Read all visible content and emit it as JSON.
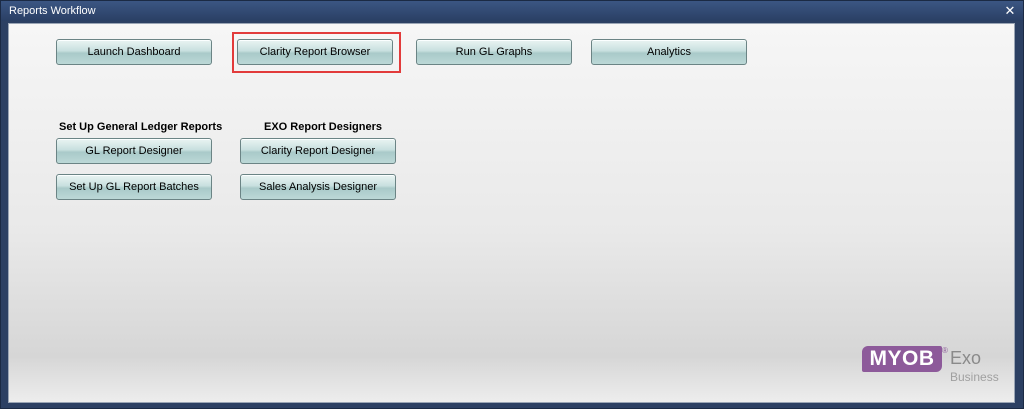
{
  "window": {
    "title": "Reports Workflow",
    "close_symbol": "✕"
  },
  "top_buttons": {
    "launch_dashboard": "Launch Dashboard",
    "clarity_report_browser": "Clarity Report Browser",
    "run_gl_graphs": "Run GL Graphs",
    "analytics": "Analytics"
  },
  "gl_section": {
    "heading": "Set Up General Ledger Reports",
    "gl_report_designer": "GL Report Designer",
    "setup_gl_report_batches": "Set Up GL Report Batches"
  },
  "exo_section": {
    "heading": "EXO Report Designers",
    "clarity_report_designer": "Clarity Report Designer",
    "sales_analysis_designer": "Sales Analysis Designer"
  },
  "logo": {
    "brand": "MYOB",
    "registered": "®",
    "product": "Exo",
    "edition": "Business"
  },
  "colors": {
    "highlight": "#e23b3b",
    "myob_purple": "#8d5a9a",
    "titlebar": "#2c4063"
  }
}
